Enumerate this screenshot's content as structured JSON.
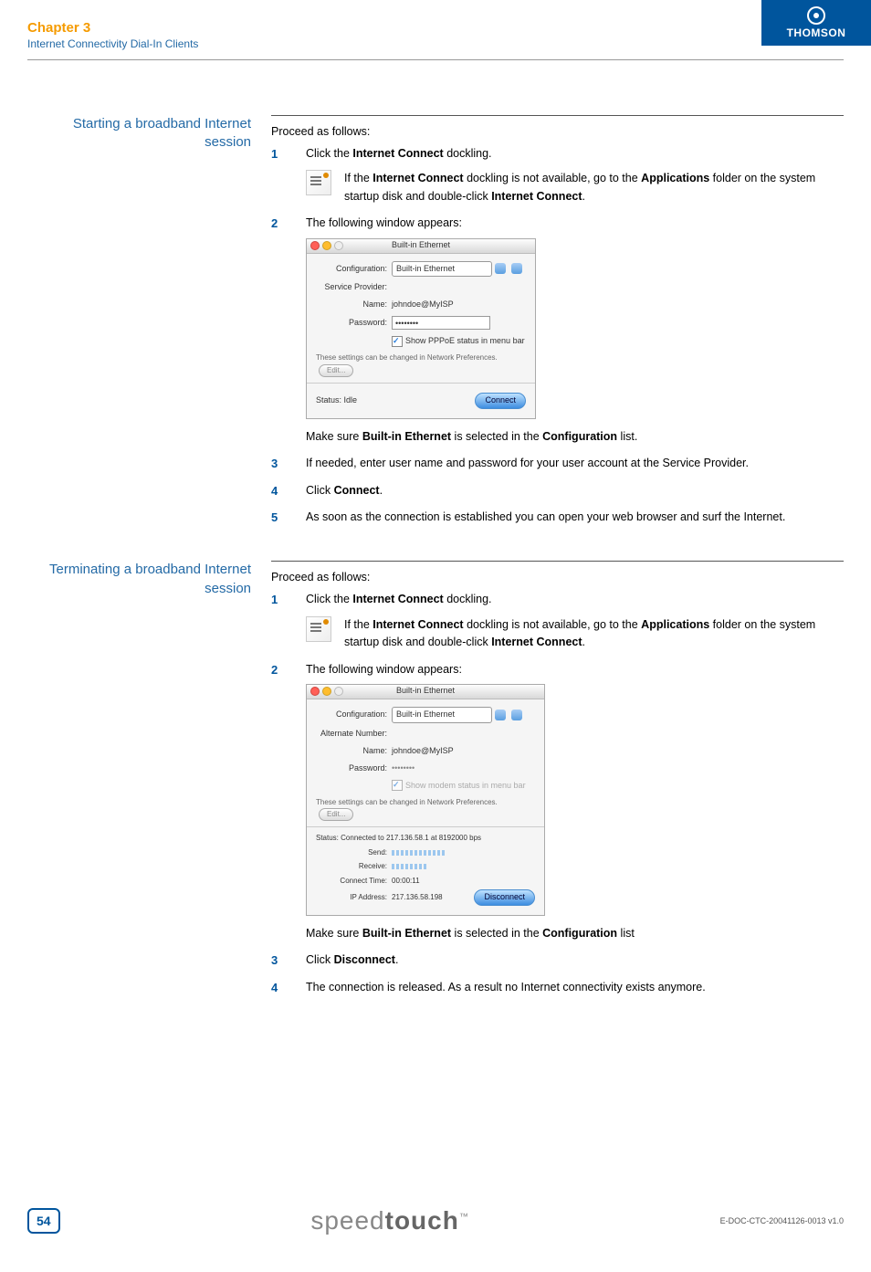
{
  "header": {
    "chapter": "Chapter 3",
    "subtitle": "Internet Connectivity Dial-In Clients",
    "brand": "THOMSON"
  },
  "section1": {
    "heading": "Starting a broadband Internet session",
    "intro": "Proceed as follows:",
    "step1": {
      "text_a": "Click the ",
      "bold_a": "Internet Connect",
      "text_b": " dockling.",
      "note_a": "If the ",
      "note_bold1": "Internet Connect",
      "note_b": " dockling is not available, go to the ",
      "note_bold2": "Applications",
      "note_c": " folder on the system startup disk and double-click ",
      "note_bold3": "Internet Connect",
      "note_d": "."
    },
    "step2_intro": "The following window appears:",
    "win1": {
      "title": "Built-in Ethernet",
      "config_label": "Configuration:",
      "config_value": "Built-in Ethernet",
      "sp_label": "Service Provider:",
      "name_label": "Name:",
      "name_value": "johndoe@MyISP",
      "pw_label": "Password:",
      "pw_value": "••••••••",
      "cb_label": "Show PPPoE status in menu bar",
      "prefs": "These settings can be changed in Network Preferences.",
      "edit": "Edit...",
      "status_label": "Status:",
      "status_value": "Idle",
      "connect": "Connect"
    },
    "step2_after_a": "Make sure ",
    "step2_after_bold1": "Built-in Ethernet",
    "step2_after_b": " is selected in the ",
    "step2_after_bold2": "Configuration",
    "step2_after_c": " list.",
    "step3": "If needed, enter user name and password for your user account at the Service Provider.",
    "step4_a": "Click ",
    "step4_bold": "Connect",
    "step4_b": ".",
    "step5": "As soon as the connection is established you can open your web browser and surf the Internet."
  },
  "section2": {
    "heading": "Terminating a broadband Internet session",
    "intro": "Proceed as follows:",
    "step1": {
      "text_a": "Click the ",
      "bold_a": "Internet Connect",
      "text_b": " dockling.",
      "note_a": "If the ",
      "note_bold1": "Internet Connect",
      "note_b": " dockling is not available, go to the ",
      "note_bold2": "Applications",
      "note_c": " folder on the system startup disk and double-click ",
      "note_bold3": "Internet Connect",
      "note_d": "."
    },
    "step2_intro": "The following window appears:",
    "win2": {
      "title": "Built-in Ethernet",
      "config_label": "Configuration:",
      "config_value": "Built-in Ethernet",
      "alt_label": "Alternate Number:",
      "name_label": "Name:",
      "name_value": "johndoe@MyISP",
      "pw_label": "Password:",
      "pw_value": "••••••••",
      "cb_label": "Show modem status in menu bar",
      "prefs": "These settings can be changed in Network Preferences.",
      "edit": "Edit...",
      "status_label": "Status:",
      "status_value": "Connected to 217.136.58.1 at 8192000 bps",
      "send_label": "Send:",
      "recv_label": "Receive:",
      "ct_label": "Connect Time:",
      "ct_value": "00:00:11",
      "ip_label": "IP Address:",
      "ip_value": "217.136.58.198",
      "disconnect": "Disconnect"
    },
    "step2_after_a": "Make sure ",
    "step2_after_bold1": "Built-in Ethernet",
    "step2_after_b": " is selected in the ",
    "step2_after_bold2": "Configuration",
    "step2_after_c": " list",
    "step3_a": "Click ",
    "step3_bold": "Disconnect",
    "step3_b": ".",
    "step4": "The connection is released. As a result no Internet connectivity exists anymore."
  },
  "footer": {
    "page": "54",
    "brand1": "speed",
    "brand2": "touch",
    "tm": "™",
    "docver": "E-DOC-CTC-20041126-0013 v1.0"
  }
}
